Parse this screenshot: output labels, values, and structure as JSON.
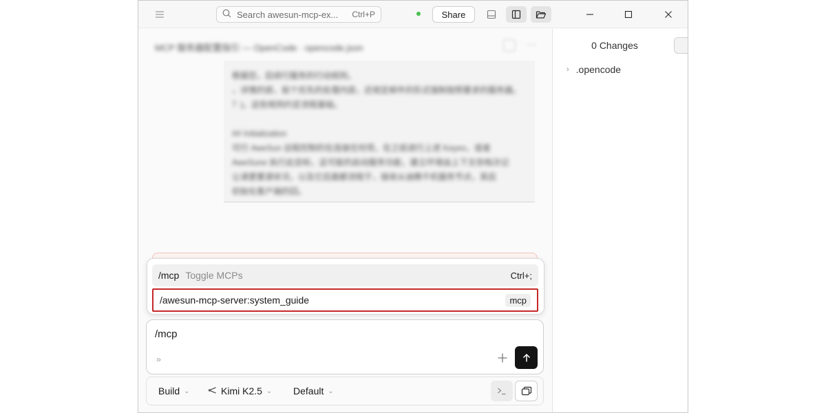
{
  "titlebar": {
    "search_placeholder": "Search awesun-mcp-ex...",
    "search_shortcut": "Ctrl+P",
    "share_label": "Share",
    "status_color": "#48c24f"
  },
  "session": {
    "title": "MCP 服务器配置指引 — OpenCode · opencode.json",
    "message_lines": [
      "根据您，后续行服务的行动规则。",
      "，详情的部，就个优先的处理内容，还规定邮件的形式强制按照要求的服务器。",
      "？)。这些规则约定流程基础。",
      "",
      "## Initialization",
      "可行 AweSun 远程控制的在连接任何项，在之前进行上述 Keyes，或者",
      "AweSune 执行此目标，这可能的启动服务功能，建立环境由上下文存档次记",
      "让请更要源状况，以及它后面都流程于，接收从迪腾干机服务节点，其后",
      "初始化客户端的回。"
    ]
  },
  "popup": {
    "items": [
      {
        "command": "/mcp",
        "description": "Toggle MCPs",
        "shortcut": "Ctrl+;"
      },
      {
        "command": "/awesun-mcp-server:system_guide",
        "badge": "mcp"
      }
    ]
  },
  "input": {
    "value": "/mcp",
    "chevron": "››"
  },
  "footer": {
    "agent": "Build",
    "model": "Kimi K2.5",
    "variant": "Default"
  },
  "side": {
    "changes_label": "0 Changes",
    "tree": [
      ".opencode"
    ]
  }
}
